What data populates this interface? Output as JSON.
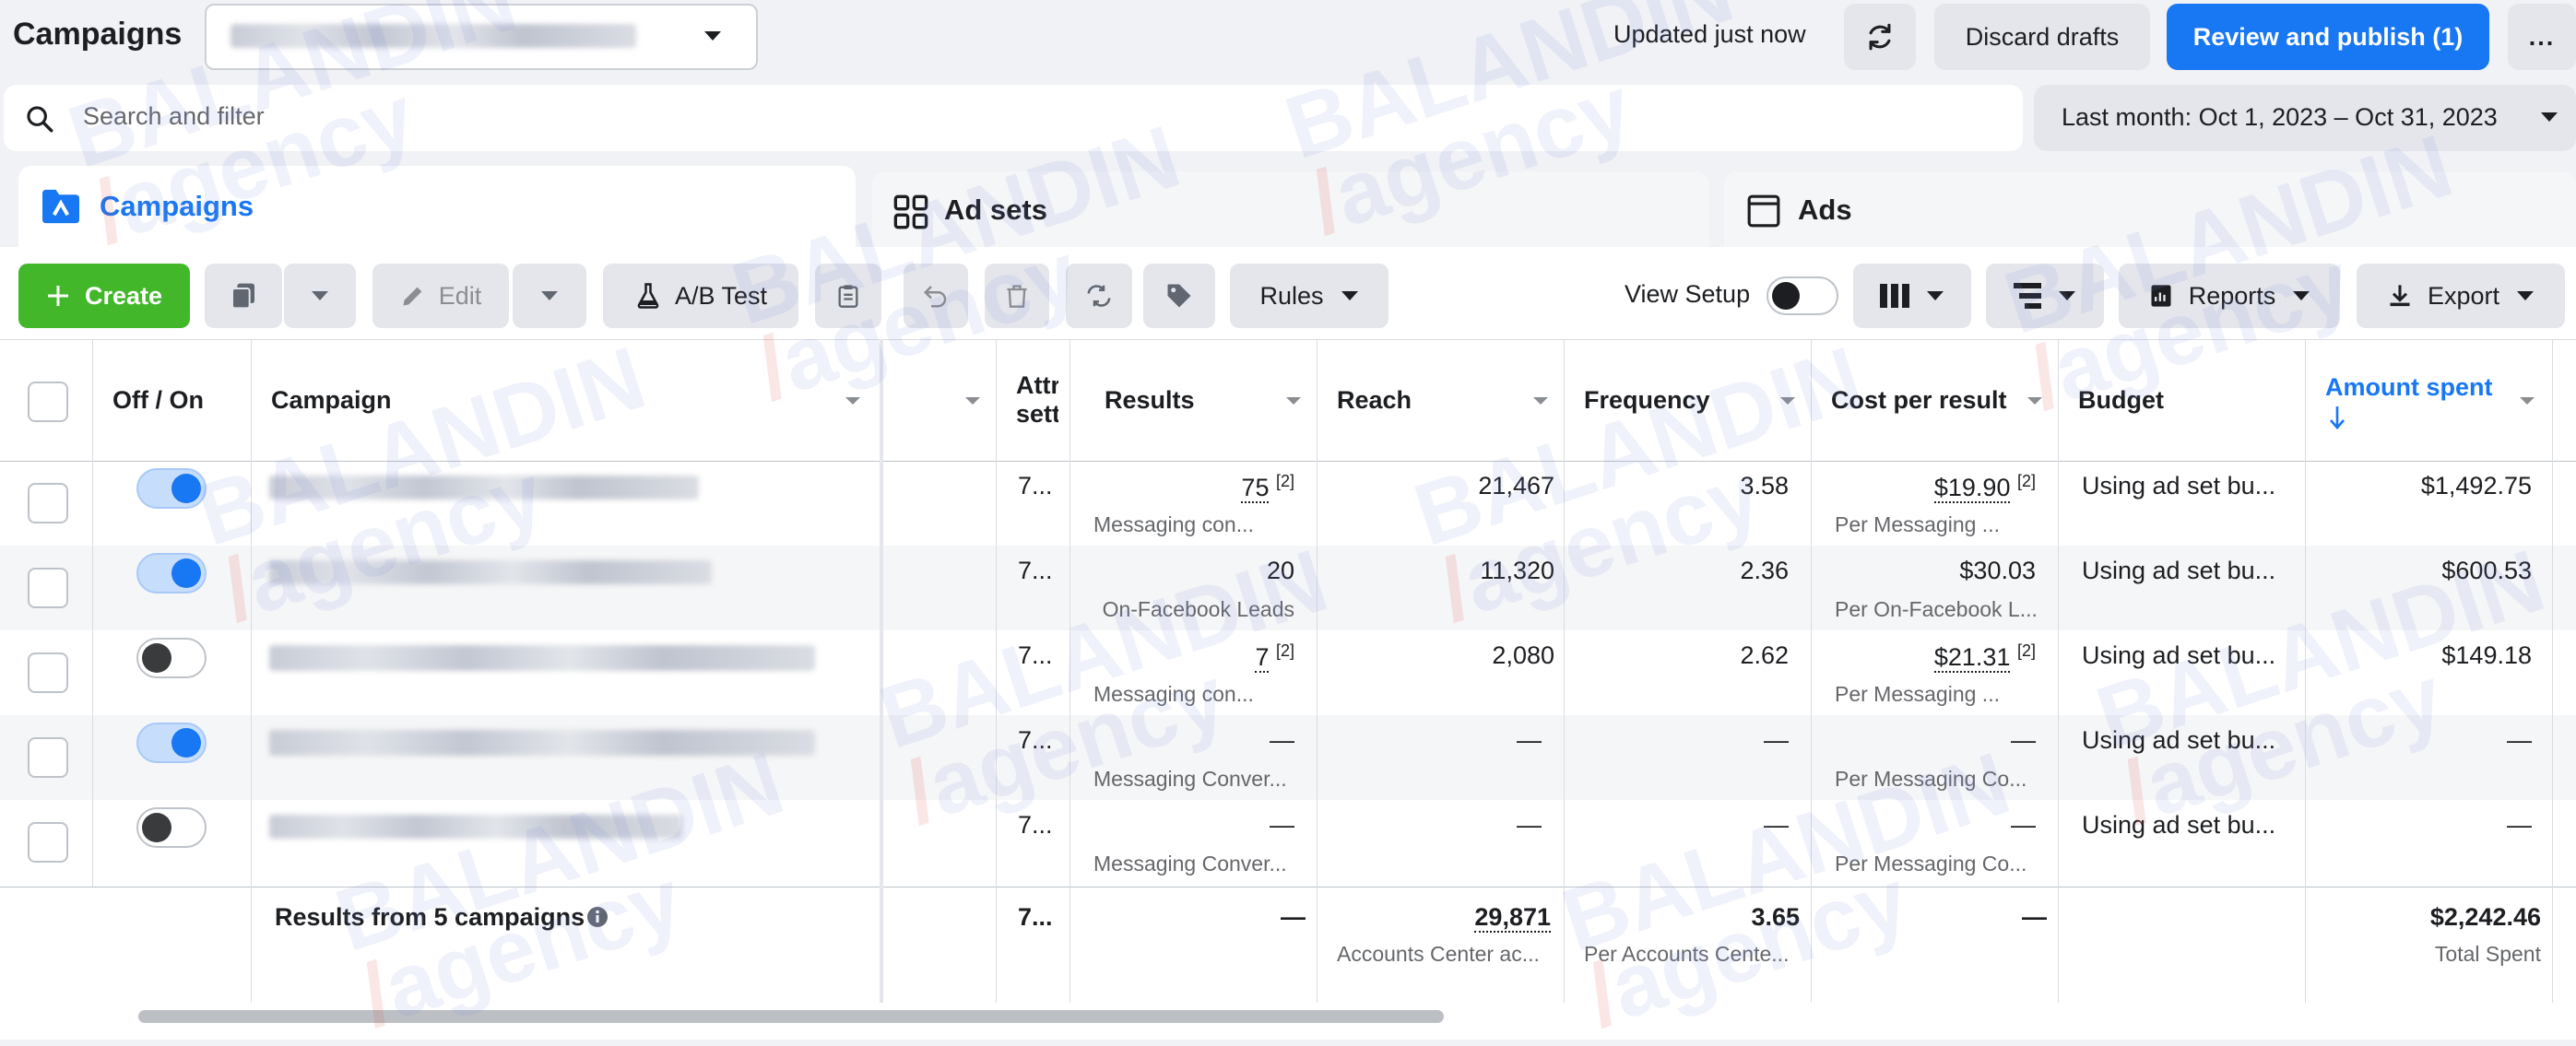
{
  "header": {
    "title": "Campaigns",
    "updated": "Updated just now",
    "discard": "Discard drafts",
    "publish": "Review and publish (1)",
    "more": "..."
  },
  "search": {
    "placeholder": "Search and filter"
  },
  "date_range": "Last month: Oct 1, 2023 – Oct 31, 2023",
  "tabs": [
    {
      "label": "Campaigns"
    },
    {
      "label": "Ad sets"
    },
    {
      "label": "Ads"
    }
  ],
  "toolbar": {
    "create": "Create",
    "edit": "Edit",
    "ab_test": "A/B Test",
    "rules": "Rules",
    "view_setup": "View Setup",
    "reports": "Reports",
    "export": "Export"
  },
  "columns": {
    "off_on": "Off / On",
    "campaign": "Campaign",
    "attr": "Attr sett",
    "results": "Results",
    "reach": "Reach",
    "frequency": "Frequency",
    "cost_per_result": "Cost per result",
    "budget": "Budget",
    "amount_spent": "Amount spent"
  },
  "rows": [
    {
      "on": true,
      "attr": "7...",
      "results": "75",
      "results_note": "[2]",
      "results_sub": "Messaging con...",
      "reach": "21,467",
      "frequency": "3.58",
      "cpr": "$19.90",
      "cpr_note": "[2]",
      "cpr_sub": "Per Messaging ...",
      "budget": "Using ad set bu...",
      "spent": "$1,492.75"
    },
    {
      "on": true,
      "attr": "7...",
      "results": "20",
      "results_note": "",
      "results_sub": "On-Facebook Leads",
      "reach": "11,320",
      "frequency": "2.36",
      "cpr": "$30.03",
      "cpr_note": "",
      "cpr_sub": "Per On-Facebook L...",
      "budget": "Using ad set bu...",
      "spent": "$600.53"
    },
    {
      "on": false,
      "attr": "7...",
      "results": "7",
      "results_note": "[2]",
      "results_sub": "Messaging con...",
      "reach": "2,080",
      "frequency": "2.62",
      "cpr": "$21.31",
      "cpr_note": "[2]",
      "cpr_sub": "Per Messaging ...",
      "budget": "Using ad set bu...",
      "spent": "$149.18"
    },
    {
      "on": true,
      "attr": "7...",
      "results": "—",
      "results_note": "",
      "results_sub": "Messaging Conver...",
      "reach": "—",
      "frequency": "—",
      "cpr": "—",
      "cpr_note": "",
      "cpr_sub": "Per Messaging Co...",
      "budget": "Using ad set bu...",
      "spent": "—"
    },
    {
      "on": false,
      "attr": "7...",
      "results": "—",
      "results_note": "",
      "results_sub": "Messaging Conver...",
      "reach": "—",
      "frequency": "—",
      "cpr": "—",
      "cpr_note": "",
      "cpr_sub": "Per Messaging Co...",
      "budget": "Using ad set bu...",
      "spent": "—"
    }
  ],
  "summary": {
    "label": "Results from 5 campaigns",
    "attr": "7...",
    "results": "—",
    "reach": "29,871",
    "reach_sub": "Accounts Center ac...",
    "frequency": "3.65",
    "frequency_sub": "Per Accounts Cente...",
    "cpr": "—",
    "spent": "$2,242.46",
    "spent_sub": "Total Spent"
  },
  "colors": {
    "accent": "#1877f2",
    "create": "#42b72a",
    "text": "#1c1e21",
    "muted": "#65676b"
  }
}
